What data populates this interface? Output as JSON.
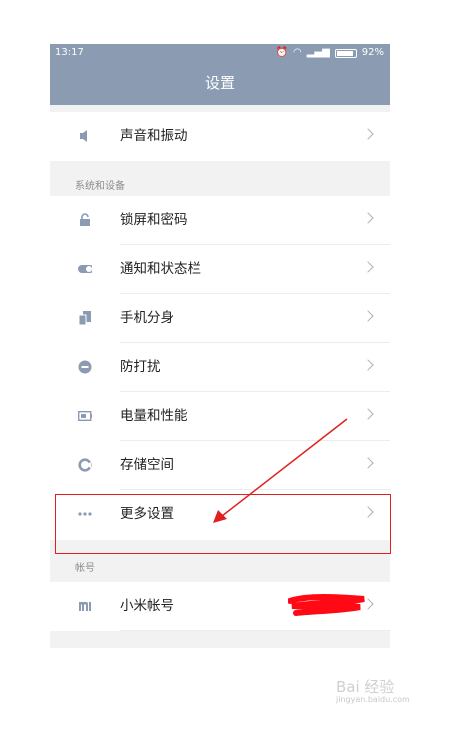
{
  "status_bar": {
    "time": "13:17",
    "battery": "92%"
  },
  "title": "设置",
  "groups": [
    {
      "items": [
        {
          "icon": "speaker-icon",
          "label": "声音和振动"
        }
      ]
    },
    {
      "header": "系统和设备",
      "items": [
        {
          "icon": "lock-icon",
          "label": "锁屏和密码"
        },
        {
          "icon": "toggle-icon",
          "label": "通知和状态栏"
        },
        {
          "icon": "phone-clone-icon",
          "label": "手机分身"
        },
        {
          "icon": "do-not-disturb-icon",
          "label": "防打扰"
        },
        {
          "icon": "battery-icon",
          "label": "电量和性能"
        },
        {
          "icon": "storage-icon",
          "label": "存储空间"
        },
        {
          "icon": "more-dots-icon",
          "label": "更多设置"
        }
      ]
    },
    {
      "header": "帐号",
      "items": [
        {
          "icon": "mi-logo-icon",
          "label": "小米帐号"
        }
      ]
    }
  ],
  "watermark": {
    "text": "Bai 经验",
    "url": "jingyan.baidu.com"
  },
  "colors": {
    "header_bg": "#8a9bb2",
    "icon": "#8a9bb2",
    "annotation": "#e02020"
  }
}
